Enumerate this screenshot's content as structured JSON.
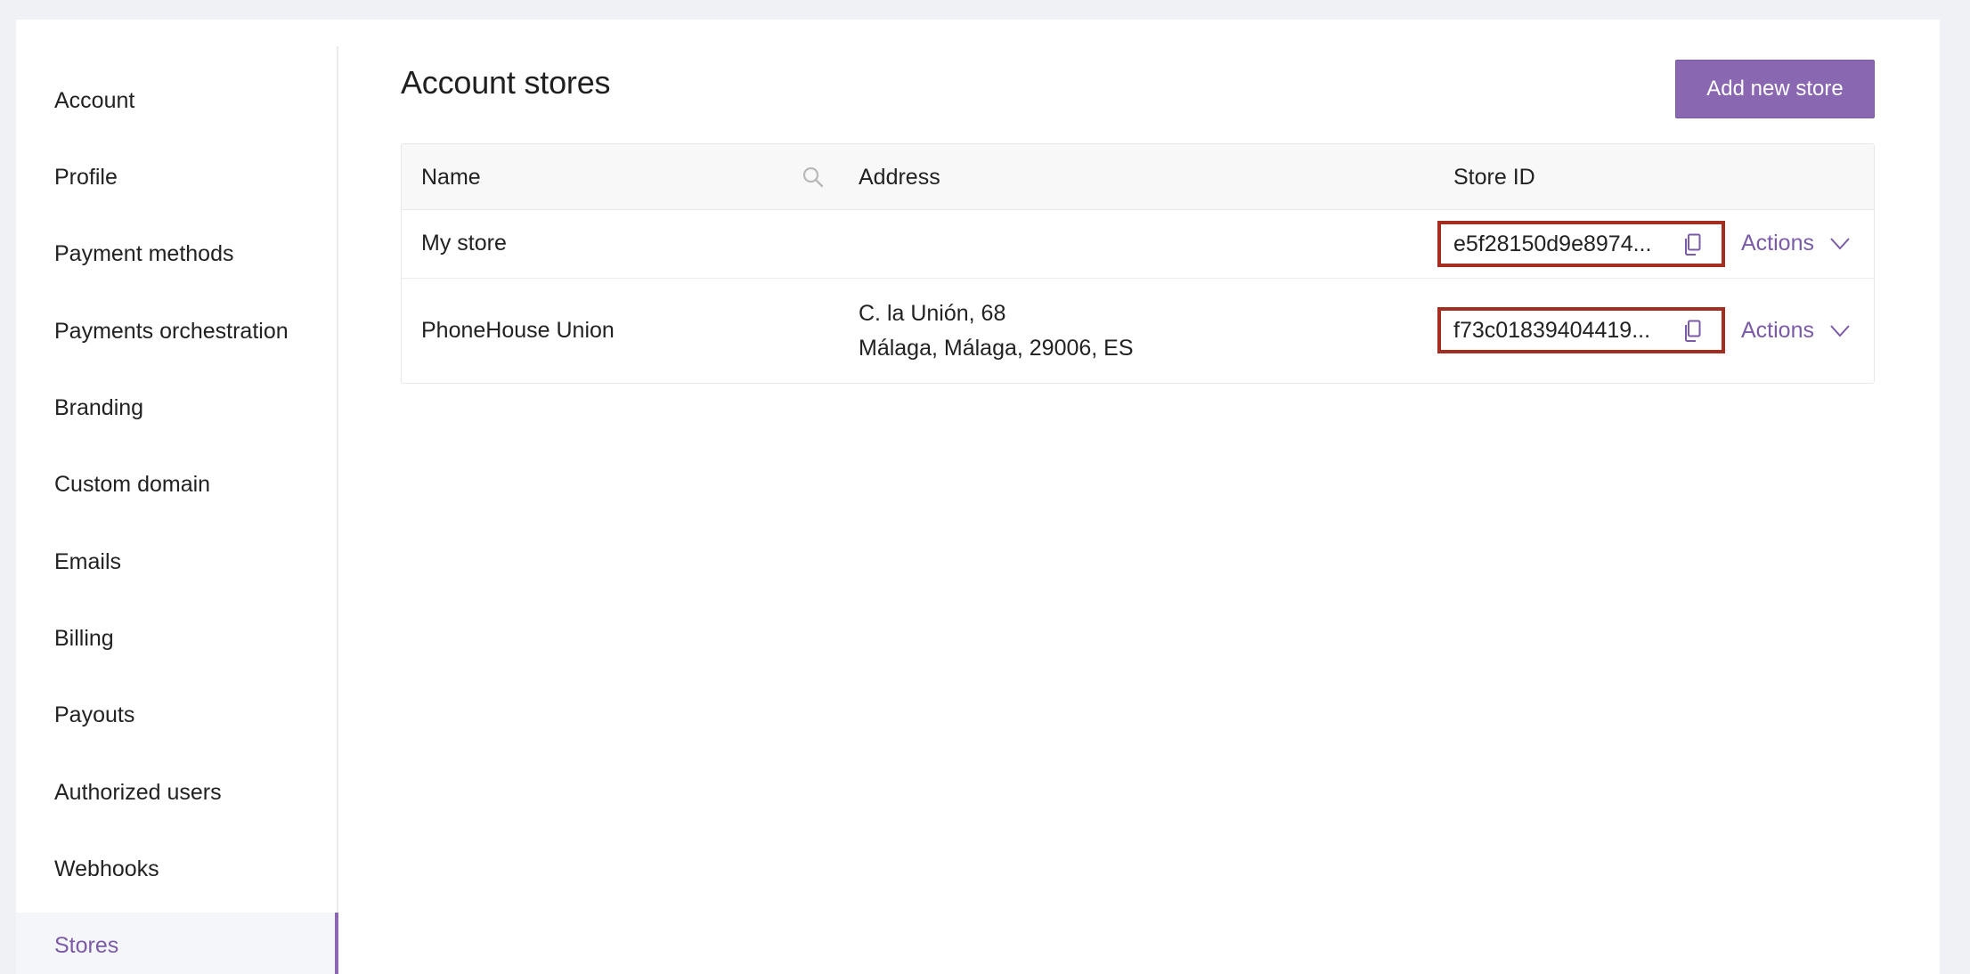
{
  "sidebar": {
    "items": [
      {
        "label": "Account"
      },
      {
        "label": "Profile"
      },
      {
        "label": "Payment methods"
      },
      {
        "label": "Payments orchestration"
      },
      {
        "label": "Branding"
      },
      {
        "label": "Custom domain"
      },
      {
        "label": "Emails"
      },
      {
        "label": "Billing"
      },
      {
        "label": "Payouts"
      },
      {
        "label": "Authorized users"
      },
      {
        "label": "Webhooks"
      },
      {
        "label": "Stores",
        "active": true
      }
    ]
  },
  "main": {
    "title": "Account stores",
    "add_button_label": "Add new store",
    "table": {
      "columns": [
        "Name",
        "Address",
        "Store ID"
      ],
      "rows": [
        {
          "name": "My store",
          "address_line1": "",
          "address_line2": "",
          "store_id": "e5f28150d9e8974...",
          "actions_label": "Actions"
        },
        {
          "name": "PhoneHouse Union",
          "address_line1": "C. la Unión, 68",
          "address_line2": "Málaga, Málaga, 29006, ES",
          "store_id": "f73c01839404419...",
          "actions_label": "Actions"
        }
      ]
    }
  },
  "icons": {
    "search": "search-icon",
    "copy": "copy-icon",
    "chevron": "chevron-down-icon"
  },
  "colors": {
    "accent": "#8a67b1",
    "highlight_border": "#a32d1f",
    "background": "#f0f1f5"
  }
}
